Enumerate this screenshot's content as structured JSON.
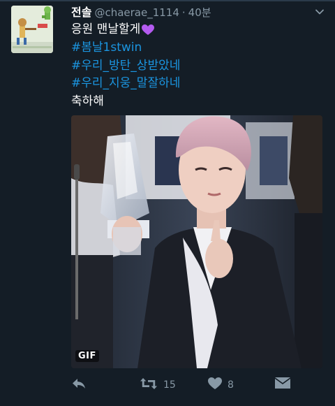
{
  "tweet": {
    "display_name": "전솔",
    "handle": "@chaerae_1114",
    "separator": "·",
    "time": "40분",
    "text_line1": "응원 맨날할게",
    "hashtag1": "#봄날1stwin",
    "hashtag2": "#우리_방탄_상받았네",
    "hashtag3": "#우리_지웅_말잘하네",
    "text_line5": "축하해",
    "media_badge": "GIF",
    "retweet_count": "15",
    "like_count": "8"
  },
  "icons": {
    "caret": "chevron-down-icon",
    "heart_emoji": "purple-heart-emoji",
    "reply": "reply-icon",
    "retweet": "retweet-icon",
    "like": "heart-icon",
    "dm": "direct-message-icon"
  },
  "colors": {
    "background": "#141d26",
    "hashtag": "#1b95e0",
    "muted": "#8899a6",
    "emoji_heart": "#b45bf0"
  }
}
